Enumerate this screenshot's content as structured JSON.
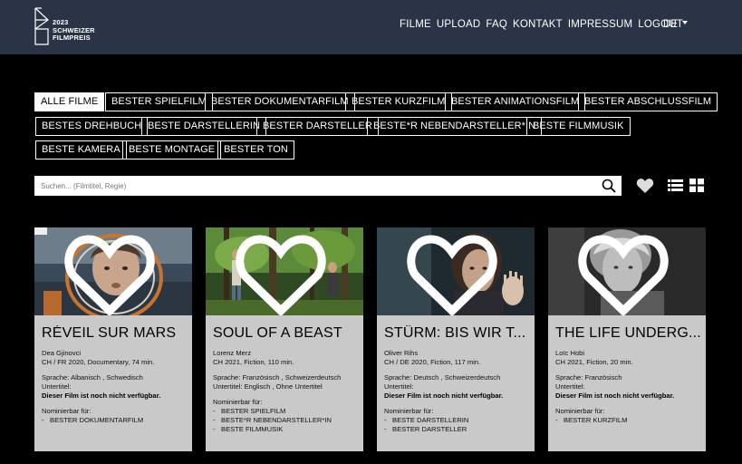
{
  "header": {
    "logo": {
      "year": "2023",
      "line1": "SCHWEIZER",
      "line2": "FILMPREIS"
    },
    "nav": [
      "FILME",
      "UPLOAD",
      "FAQ",
      "KONTAKT",
      "IMPRESSUM",
      "LOGOUT"
    ],
    "language": "DE"
  },
  "filters": {
    "row1": [
      "ALLE FILME",
      "BESTER SPIELFILM",
      "BESTER DOKUMENTARFILM",
      "BESTER KURZFILM",
      "BESTER ANIMATIONSFILM",
      "BESTER ABSCHLUSSFILM"
    ],
    "row2": [
      "BESTES DREHBUCH",
      "BESTE DARSTELLERIN",
      "BESTER DARSTELLER",
      "BESTE*R NEBENDARSTELLER*IN",
      "BESTE FILMMUSIK"
    ],
    "row3": [
      "BESTE KAMERA",
      "BESTE MONTAGE",
      "BESTER TON"
    ],
    "active": "ALLE FILME"
  },
  "search": {
    "placeholder": "Suchen... (Filmtitel, Regie)",
    "value": ""
  },
  "icons": {
    "search": "search-icon",
    "favorites": "heart-icon",
    "list_view": "list-view-icon",
    "grid_view": "grid-view-icon"
  },
  "cards": [
    {
      "title": "RÉVEIL SUR MARS",
      "director": "Dea Gjinovci",
      "info": "CH / FR 2020, Documentary, 74 min.",
      "sprache": "Sprache: Albanisch , Schwedisch",
      "untertitel": "Untertitel:",
      "availability": "Dieser Film ist noch nicht verfügbar.",
      "nominierbar": "Nominierbar für:",
      "nominations": [
        "BESTER DOKUMENTARFILM"
      ]
    },
    {
      "title": "SOUL OF A BEAST",
      "director": "Lorenz Merz",
      "info": "CH 2021, Fiction, 110 min.",
      "sprache": "Sprache: Französisch , Schweizerdeutsch",
      "untertitel": "Untertitel: Englisch , Ohne Untertitel",
      "availability": "",
      "nominierbar": "Nominierbar für:",
      "nominations": [
        "BESTER SPIELFILM",
        "BESTE*R NEBENDARSTELLER*IN",
        "BESTE FILMMUSIK"
      ]
    },
    {
      "title": "STÜRM: BIS WIR T...",
      "director": "Oliver Rihs",
      "info": "CH / DE 2020, Fiction, 117 min.",
      "sprache": "Sprache: Deutsch , Schweizerdeutsch",
      "untertitel": "Untertitel:",
      "availability": "Dieser Film ist noch nicht verfügbar.",
      "nominierbar": "Nominierbar für:",
      "nominations": [
        "BESTE DARSTELLERIN",
        "BESTER DARSTELLER"
      ]
    },
    {
      "title": "THE LIFE UNDERG...",
      "director": "Loïc Hobi",
      "info": "CH 2021, Fiction, 20 min.",
      "sprache": "Sprache: Französisch",
      "untertitel": "Untertitel:",
      "availability": "Dieser Film ist noch nicht verfügbar.",
      "nominierbar": "Nominierbar für:",
      "nominations": [
        "BESTER KURZFILM"
      ]
    }
  ]
}
